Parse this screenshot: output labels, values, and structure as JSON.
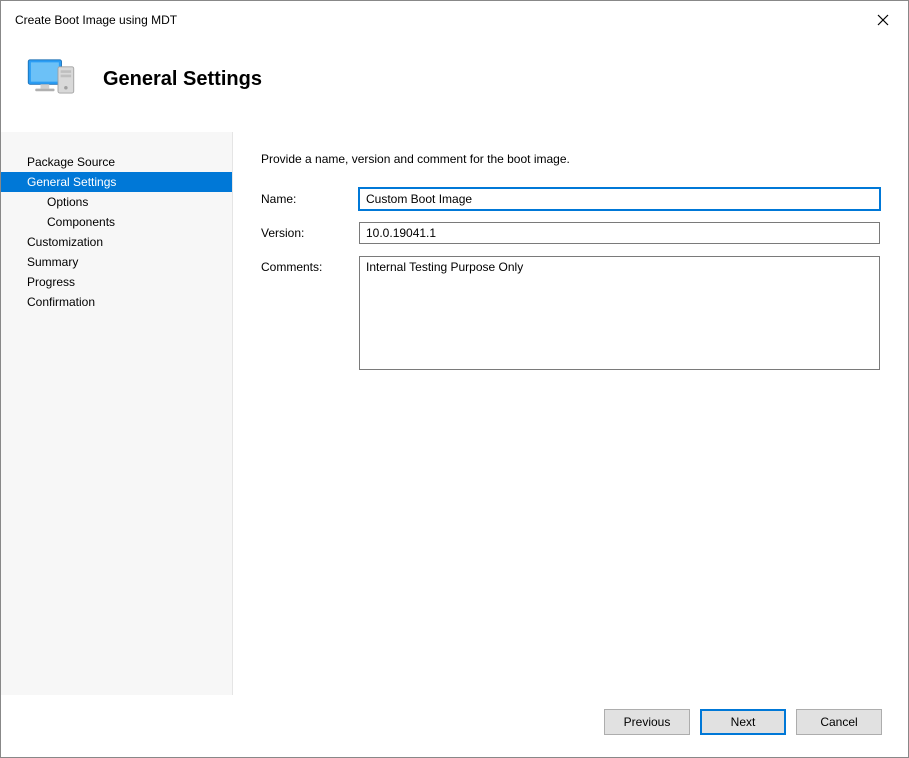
{
  "window": {
    "title": "Create Boot Image using MDT"
  },
  "header": {
    "title": "General Settings"
  },
  "sidebar": {
    "items": [
      {
        "label": "Package Source",
        "indent": false,
        "selected": false
      },
      {
        "label": "General Settings",
        "indent": false,
        "selected": true
      },
      {
        "label": "Options",
        "indent": true,
        "selected": false
      },
      {
        "label": "Components",
        "indent": true,
        "selected": false
      },
      {
        "label": "Customization",
        "indent": false,
        "selected": false
      },
      {
        "label": "Summary",
        "indent": false,
        "selected": false
      },
      {
        "label": "Progress",
        "indent": false,
        "selected": false
      },
      {
        "label": "Confirmation",
        "indent": false,
        "selected": false
      }
    ]
  },
  "main": {
    "instruction": "Provide a name, version and comment for the boot image.",
    "fields": {
      "name_label": "Name:",
      "name_value": "Custom Boot Image",
      "version_label": "Version:",
      "version_value": "10.0.19041.1",
      "comments_label": "Comments:",
      "comments_value": "Internal Testing Purpose Only"
    }
  },
  "buttons": {
    "previous": "Previous",
    "next": "Next",
    "cancel": "Cancel"
  }
}
